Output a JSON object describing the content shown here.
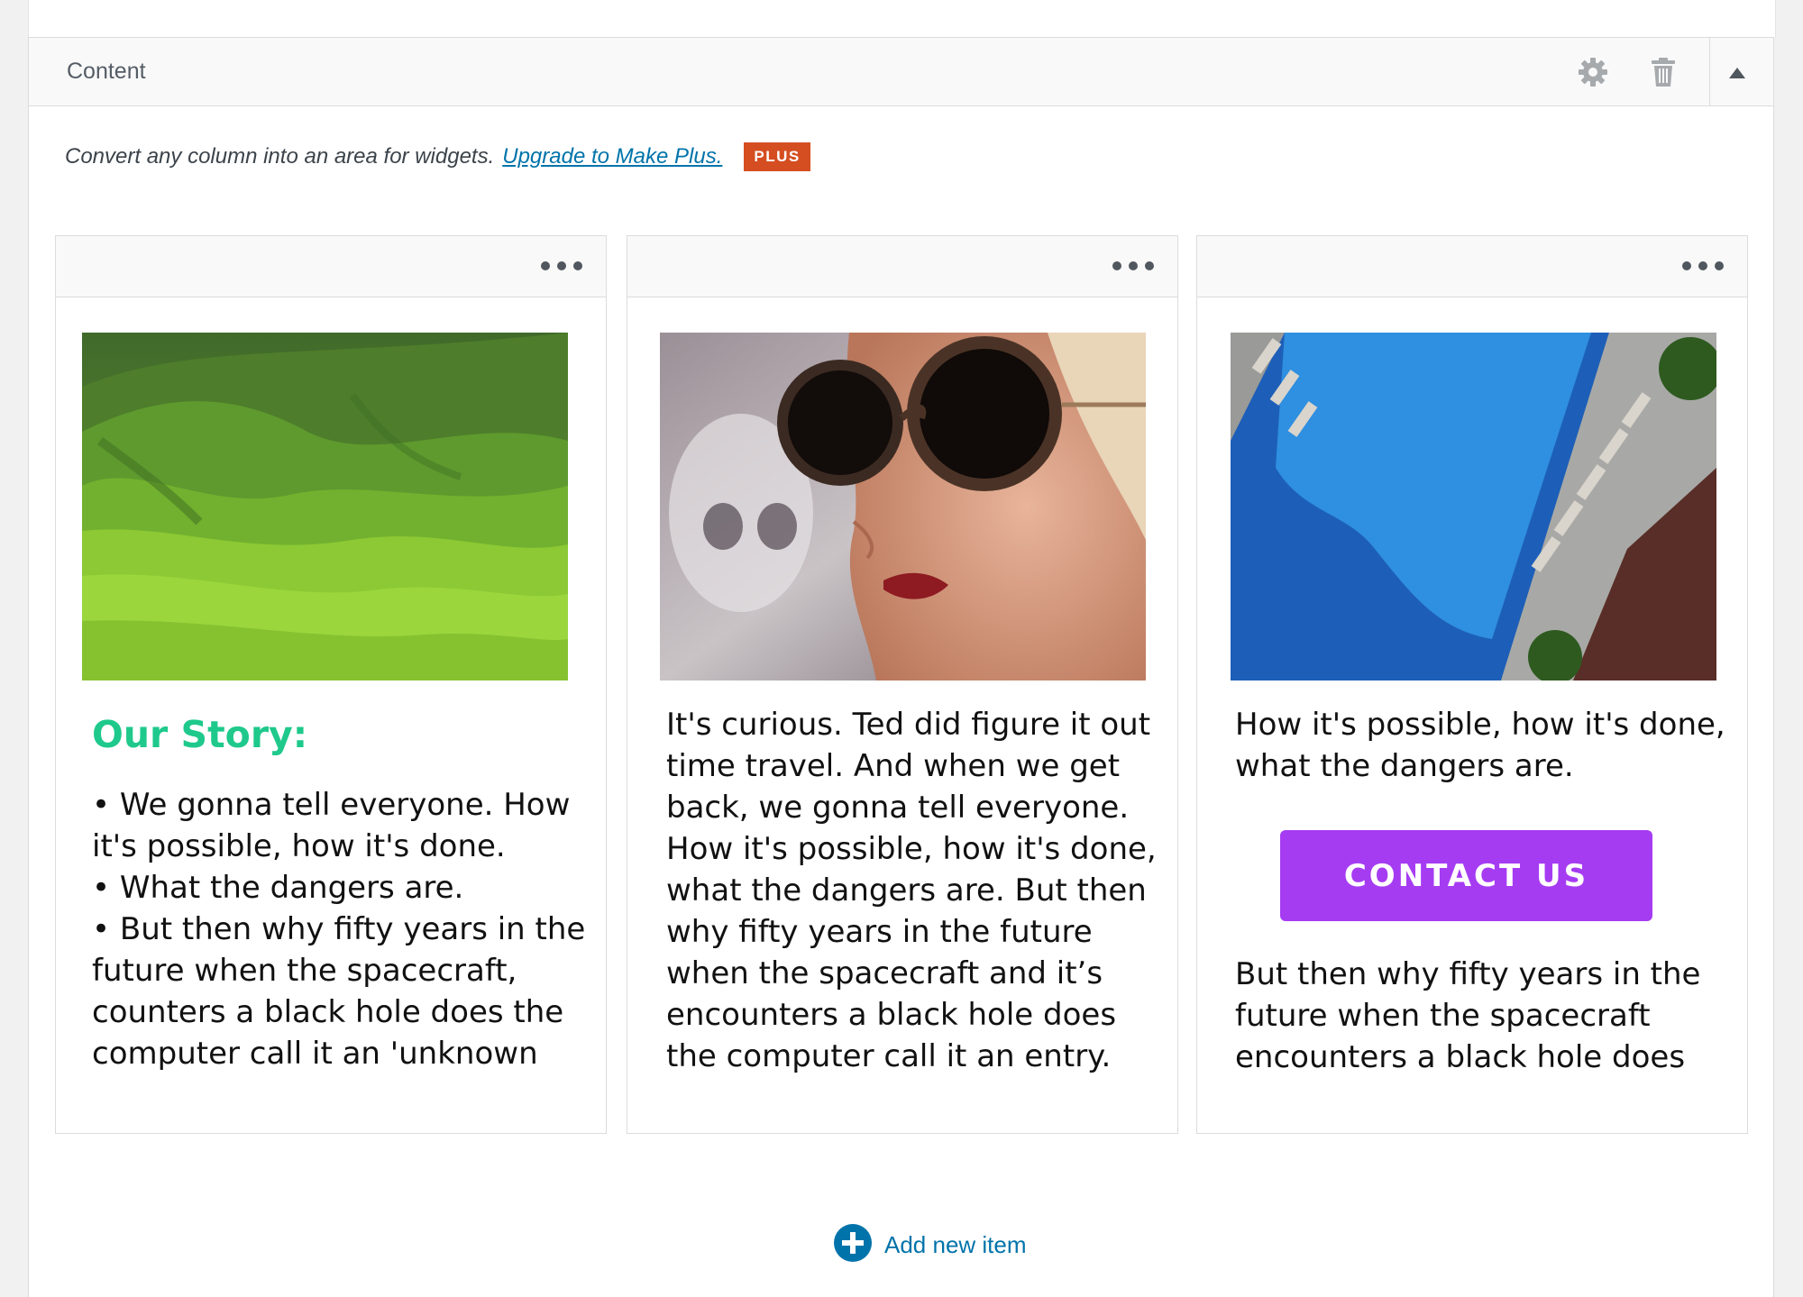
{
  "section": {
    "title": "Content",
    "icons": {
      "settings": "gear-icon",
      "delete": "trash-icon",
      "collapse": "triangle-up-icon"
    }
  },
  "notice": {
    "text": "Convert any column into an area for widgets.",
    "link": "Upgrade to Make Plus.",
    "badge": "PLUS"
  },
  "columns": [
    {
      "image": "green rolling hills landscape",
      "heading": "Our Story:",
      "lines": [
        "• We gonna tell everyone. How",
        "it's possible, how it's done.",
        "• What the dangers are.",
        "• But then why fifty years in the",
        "future when the spacecraft,",
        "counters a black hole does the",
        "computer call it an 'unknown"
      ]
    },
    {
      "image": "woman wearing round tortoiseshell sunglasses",
      "lines": [
        "It's curious. Ted did figure it out",
        "time travel. And when we get",
        "back, we gonna tell everyone.",
        "How it's possible, how it's done,",
        "what the dangers are. But then",
        "why fifty years in the future",
        "when the spacecraft  and it’s",
        "encounters a black hole does",
        "the computer call it an entry."
      ]
    },
    {
      "image": "aerial view of a hotel swimming pool",
      "lines_top": [
        "How it's possible, how it's done,",
        "what the dangers are."
      ],
      "button": "CONTACT US",
      "lines_bottom": [
        "But then why fifty years in the",
        "future when the spacecraft",
        "encounters a black hole does"
      ]
    }
  ],
  "add_item": {
    "label": "Add new item",
    "icon": "plus-circle-icon"
  },
  "colors": {
    "link": "#0073aa",
    "badge": "#d54e21",
    "heading_green": "#1ec98b",
    "button_purple": "#a63cf2"
  }
}
